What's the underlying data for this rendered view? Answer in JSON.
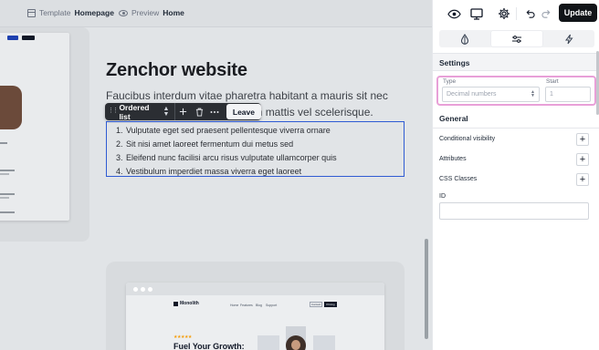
{
  "topbar": {
    "template_label": "Template",
    "template_name": "Homepage",
    "preview_label": "Preview",
    "preview_name": "Home"
  },
  "canvas": {
    "heading": "Zenchor website",
    "paragraph_line1": "Faucibus interdum vitae pharetra habitant a mauris sit nec",
    "paragraph_line2": "tae in mattis vel scelerisque.",
    "toolbar": {
      "element_type": "Ordered list",
      "leave_label": "Leave",
      "add_icon": "plus-icon",
      "delete_icon": "trash-icon",
      "more_icon": "ellipsis-icon"
    },
    "list_items": [
      {
        "num": "1.",
        "text": "Vulputate eget sed praesent pellentesque viverra ornare"
      },
      {
        "num": "2.",
        "text": "Sit nisi amet laoreet fermentum dui metus sed"
      },
      {
        "num": "3.",
        "text": "Eleifend nunc facilisi arcu risus vulputate ullamcorper quis"
      },
      {
        "num": "4.",
        "text": "Vestibulum imperdiet massa viverra eget laoreet"
      }
    ],
    "preview_template": {
      "logo": "Monolith",
      "nav": [
        "Home",
        "Features",
        "Blog",
        "Support"
      ],
      "contact": "Contact",
      "pricing": "Pricing",
      "stars": "★★★★★",
      "hero": "Fuel Your Growth:"
    }
  },
  "panel": {
    "update_label": "Update",
    "settings_title": "Settings",
    "type_label": "Type",
    "type_placeholder": "Decimal numbers",
    "start_label": "Start",
    "start_placeholder": "1",
    "general_title": "General",
    "conditional_visibility": "Conditional visibility",
    "attributes": "Attributes",
    "css_classes": "CSS Classes",
    "id_label": "ID"
  },
  "colors": {
    "selection_border": "#2f5bd3",
    "highlight_gradient_start": "#f6b37a",
    "highlight_gradient_end": "#e8a0d8",
    "update_button": "#111418"
  }
}
